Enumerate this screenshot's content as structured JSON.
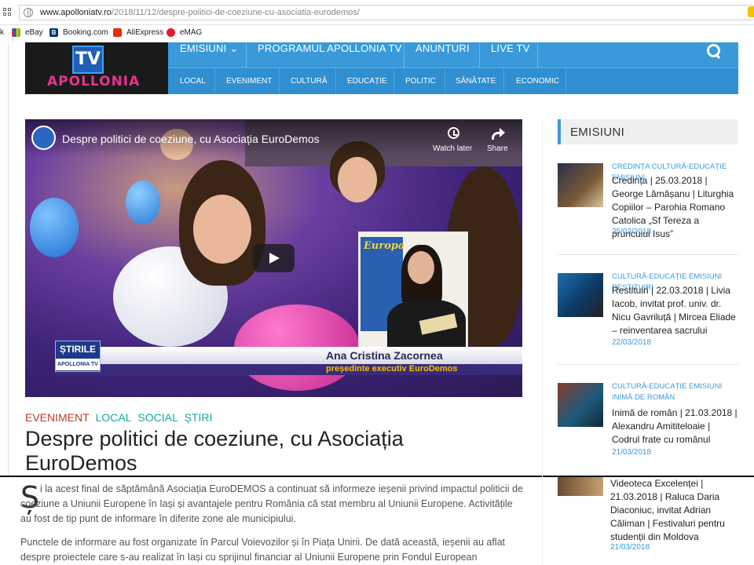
{
  "browser": {
    "url_host": "www.apolloniatv.ro",
    "url_path": "/2018/11/12/despre-politici-de-coeziune-cu-asociatia-eurodemos/",
    "bookmarks": [
      {
        "label": "k",
        "color": "#777777"
      },
      {
        "label": "eBay",
        "color": "#e53238"
      },
      {
        "label": "Booking.com",
        "color": "#003580"
      },
      {
        "label": "AliExpress",
        "color": "#e62e04"
      },
      {
        "label": "eMAG",
        "color": "#e21c2a"
      }
    ]
  },
  "site": {
    "logo_tv": "TV",
    "logo_brand": "APOLLONIA",
    "nav_primary": [
      "EMISIUNI ⌄",
      "PROGRAMUL APOLLONIA TV",
      "ANUNȚURI",
      "LIVE TV"
    ],
    "nav_secondary": [
      "LOCAL",
      "EVENIMENT",
      "CULTURĂ",
      "EDUCAȚIE",
      "POLITIC",
      "SĂNĂTATE",
      "ECONOMIC"
    ]
  },
  "video": {
    "title": "Despre politici de coeziune, cu Asociația EuroDemos",
    "watch_later": "Watch later",
    "share": "Share",
    "poster_text": "Europa",
    "brand_top": "ȘTIRILE",
    "brand_bottom": "APOLLONIA TV",
    "person_name": "Ana Cristina Zacornea",
    "person_role": "președinte executiv EuroDemos"
  },
  "article": {
    "categories": [
      {
        "label": "EVENIMENT",
        "color": "#c0392b"
      },
      {
        "label": "LOCAL",
        "color": "#16a9a0"
      },
      {
        "label": "SOCIAL",
        "color": "#16a9a0"
      },
      {
        "label": "ȘTIRI",
        "color": "#16a9a0"
      }
    ],
    "title": "Despre politici de coeziune, cu Asociația EuroDemos",
    "dropcap": "Ș",
    "para1": "i la acest final de săptămână Asociația EuroDEMOS  a continuat să informeze ieșenii privind impactul politicii de coeziune a Uniunii Europene în Iași și avantajele pentru România că stat membru al Uniunii Europene. Activitățile au fost de tip punt de informare în diferite zone ale municipiului.",
    "para2": "Punctele de informare au fost organizate  în Parcul Voievozilor și în Piața Unirii. De dată această, ieșenii au aflat despre proiectele care s-au realizat în Iași cu sprijinul financiar al Uniunii Europene prin Fondul European"
  },
  "sidebar": {
    "heading": "EMISIUNI",
    "posts": [
      {
        "category": "CREDINȚA CULTURĂ-EDUCAȚIE EMISIUNI",
        "title": "Credința | 25.03.2018 | George Lămășanu | Liturghia Copiilor – Parohia Romano Catolica „Sf Tereza a pruncului Isus”",
        "date": "25/03/2018"
      },
      {
        "category": "CULTURĂ-EDUCAȚIE EMISIUNI RESTITUIRI",
        "title": "Restituiri | 22.03.2018 | Livia Iacob, invitat prof. univ. dr. Nicu Gavriluță | Mircea Eliade – reinventarea sacrului",
        "date": "22/03/2018"
      },
      {
        "category": "CULTURĂ-EDUCAȚIE EMISIUNI INIMĂ DE ROMÂN",
        "title": "Inimă de român | 21.03.2018 | Alexandru Amititeloaie | Codrul frate cu românul",
        "date": "21/03/2018"
      },
      {
        "category": "",
        "title": "Videoteca Excelenței | 21.03.2018 | Raluca Daria Diaconiuc, invitat Adrian Căliman | Festivaluri pentru studenții din Moldova",
        "date": "21/03/2018"
      }
    ]
  },
  "colors": {
    "nav_blue": "#3a9ad9",
    "nav_blue_dark": "#2f8fd0",
    "accent_red": "#c0392b",
    "accent_teal": "#16a9a0"
  }
}
